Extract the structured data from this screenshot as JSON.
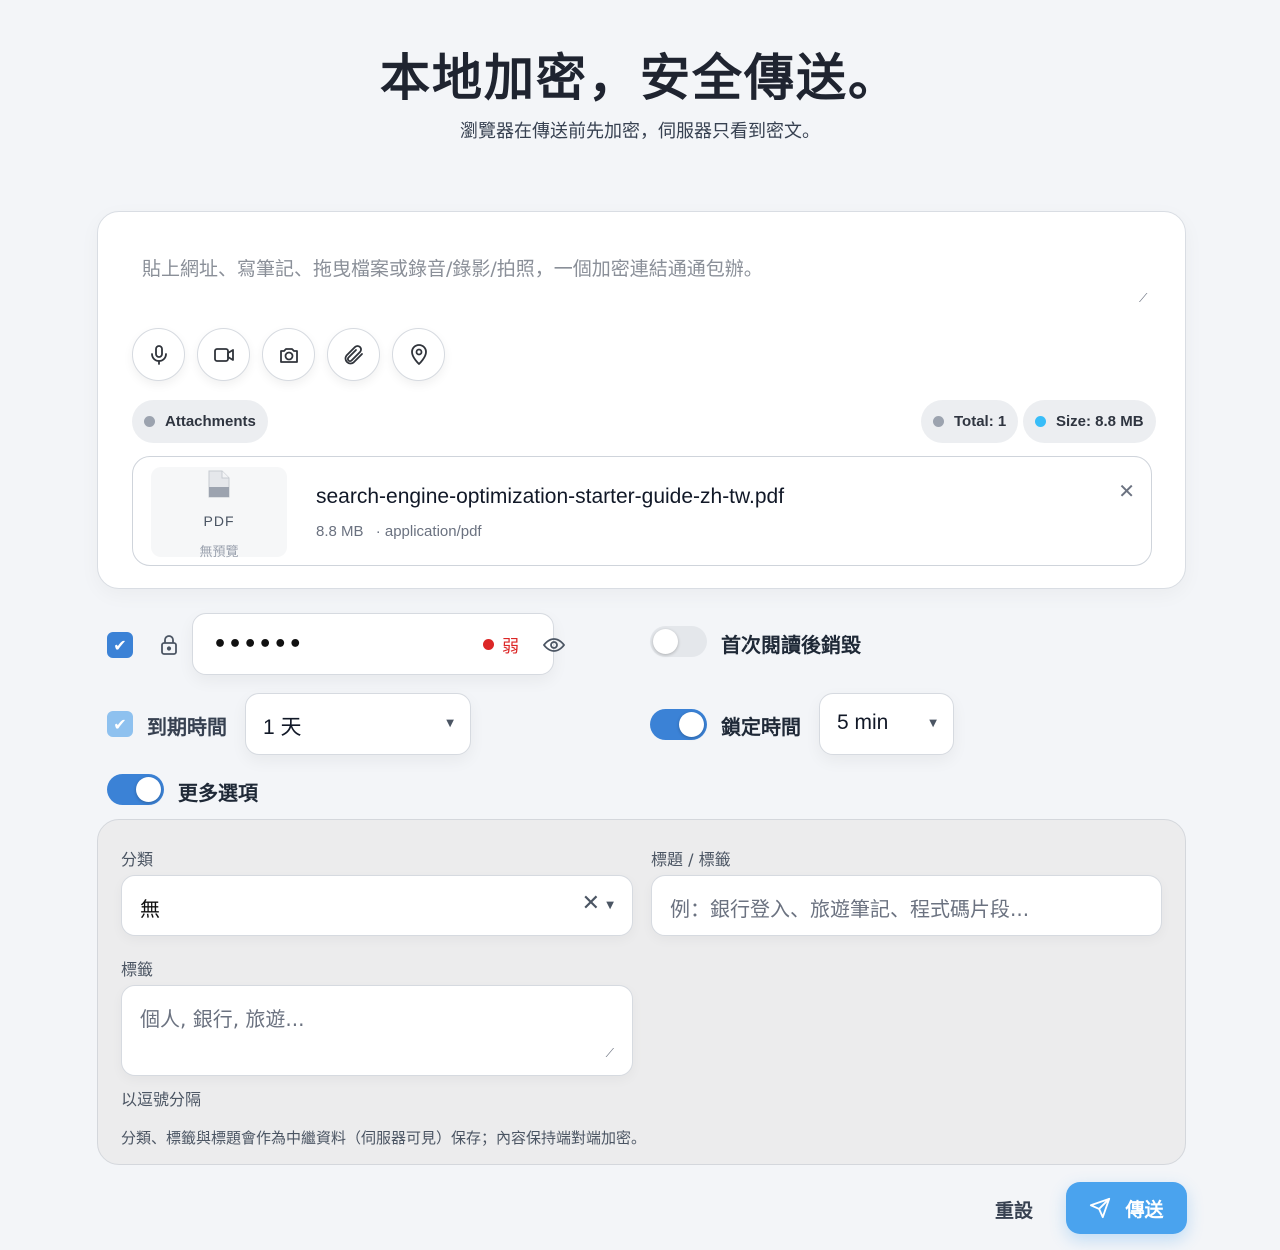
{
  "header": {
    "title": "本地加密，安全傳送。",
    "subtitle": "瀏覽器在傳送前先加密，伺服器只看到密文。"
  },
  "composer": {
    "placeholder": "貼上網址、寫筆記、拖曳檔案或錄音/錄影/拍照，一個加密連結通通包辦。",
    "tools": [
      "microphone-icon",
      "video-camera-icon",
      "camera-icon",
      "paperclip-icon",
      "location-pin-icon"
    ]
  },
  "attachments": {
    "label": "Attachments",
    "total": "Total: 1",
    "size": "Size: 8.8 MB",
    "file": {
      "type": "PDF",
      "no_preview": "無預覽",
      "name": "search-engine-optimization-starter-guide-zh-tw.pdf",
      "size": "8.8 MB",
      "mime": "· application/pdf"
    }
  },
  "options": {
    "password_enabled": true,
    "password_masked": "••••••",
    "password_strength": "弱",
    "burn_after_read_label": "首次閱讀後銷毀",
    "burn_after_read": false,
    "expiry_enabled": true,
    "expiry_label": "到期時間",
    "expiry_value": "1 天",
    "lock_time_label": "鎖定時間",
    "lock_time_enabled": true,
    "lock_time_value": "5 min",
    "more_options_label": "更多選項",
    "more_options": true
  },
  "more_panel": {
    "category_label": "分類",
    "category_value": "無",
    "title_label": "標題 / 標籤",
    "title_placeholder": "例：銀行登入、旅遊筆記、程式碼片段...",
    "tags_label": "標籤",
    "tags_placeholder": "個人, 銀行, 旅遊...",
    "tags_hint": "以逗號分隔",
    "note": "分類、標籤與標題會作為中繼資料（伺服器可見）保存；內容保持端對端加密。"
  },
  "actions": {
    "reset": "重設",
    "send": "傳送"
  },
  "colors": {
    "accent": "#3b82d6",
    "send": "#4aa3ee",
    "weak": "#dc2626",
    "size_dot": "#38bdf8",
    "gray_dot": "#9ca3af"
  }
}
